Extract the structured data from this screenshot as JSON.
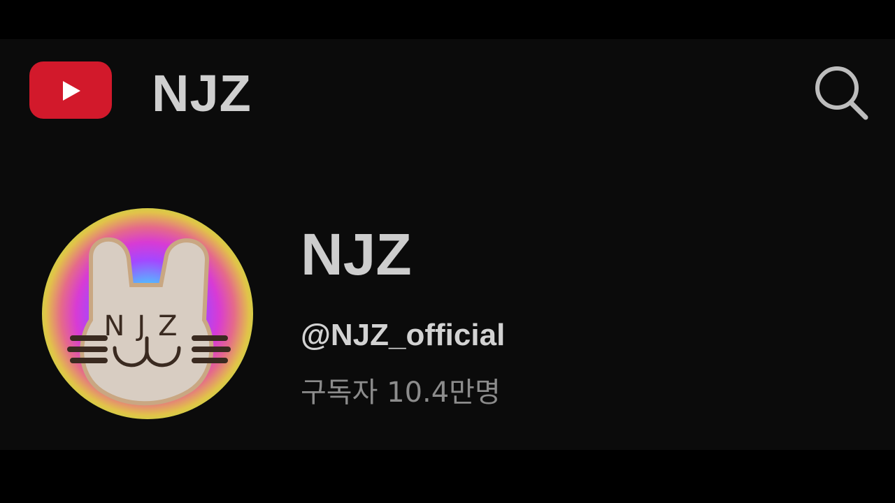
{
  "header": {
    "logo_icon": "youtube-play-icon",
    "title": "NJZ",
    "search_icon": "search-icon"
  },
  "channel": {
    "avatar_icon": "njz-bunny-avatar",
    "avatar_text": "NJZ",
    "name": "NJZ",
    "handle": "@NJZ_official",
    "subscribers": "구독자 10.4만명"
  },
  "colors": {
    "background": "#0b0b0b",
    "logo_red": "#d2192b",
    "title_text": "#cfcfcf",
    "secondary_text": "#8c8c8c"
  }
}
